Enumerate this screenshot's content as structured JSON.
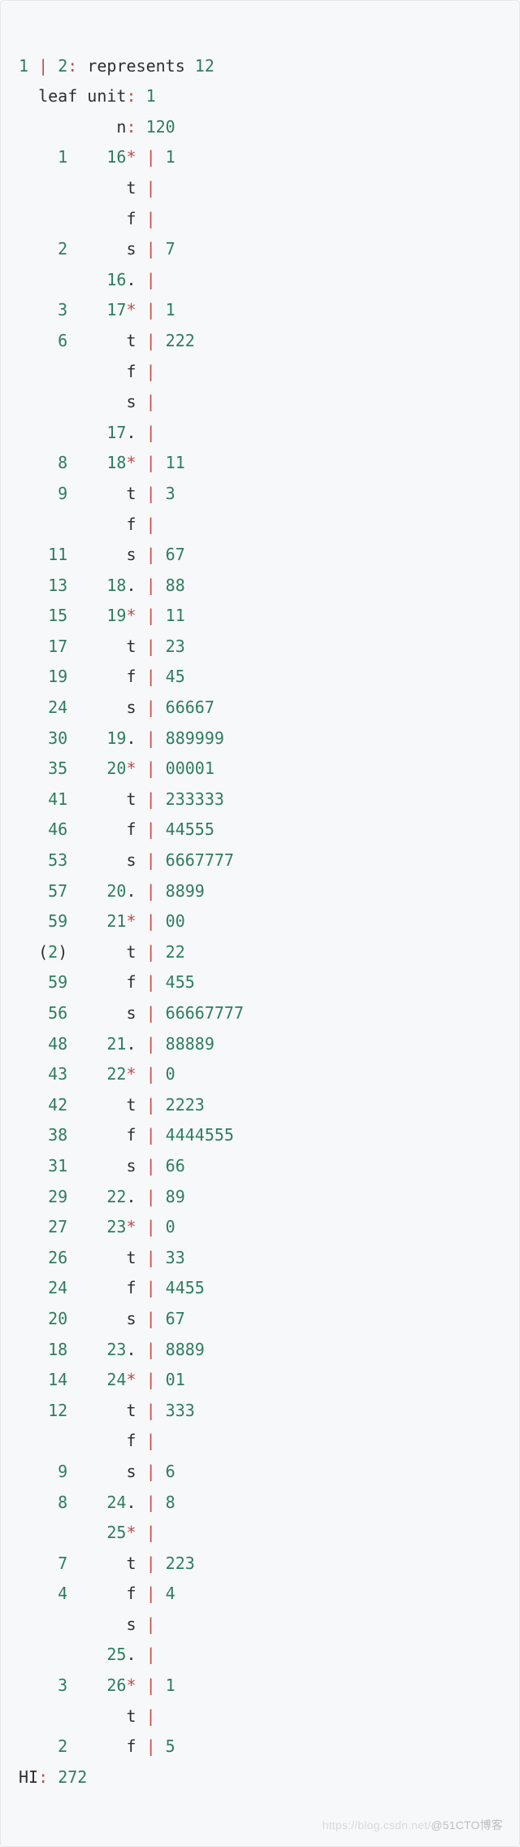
{
  "header": {
    "line1": {
      "n1": "1",
      "bar": "|",
      "n2": "2",
      "colon1": ":",
      "word": "represents",
      "n3": "12"
    },
    "line2": {
      "label": "leaf unit",
      "colon": ":",
      "val": "1"
    },
    "line3": {
      "label": "n",
      "colon": ":",
      "val": "120"
    }
  },
  "rows": [
    {
      "depth": "1",
      "stem_num": "16",
      "stem_sym": "*",
      "leaves": "1"
    },
    {
      "depth": "",
      "stem_num": "",
      "stem_sym": "t",
      "leaves": ""
    },
    {
      "depth": "",
      "stem_num": "",
      "stem_sym": "f",
      "leaves": ""
    },
    {
      "depth": "2",
      "stem_num": "",
      "stem_sym": "s",
      "leaves": "7"
    },
    {
      "depth": "",
      "stem_num": "16",
      "stem_sym": ".",
      "leaves": ""
    },
    {
      "depth": "3",
      "stem_num": "17",
      "stem_sym": "*",
      "leaves": "1"
    },
    {
      "depth": "6",
      "stem_num": "",
      "stem_sym": "t",
      "leaves": "222"
    },
    {
      "depth": "",
      "stem_num": "",
      "stem_sym": "f",
      "leaves": ""
    },
    {
      "depth": "",
      "stem_num": "",
      "stem_sym": "s",
      "leaves": ""
    },
    {
      "depth": "",
      "stem_num": "17",
      "stem_sym": ".",
      "leaves": ""
    },
    {
      "depth": "8",
      "stem_num": "18",
      "stem_sym": "*",
      "leaves": "11"
    },
    {
      "depth": "9",
      "stem_num": "",
      "stem_sym": "t",
      "leaves": "3"
    },
    {
      "depth": "",
      "stem_num": "",
      "stem_sym": "f",
      "leaves": ""
    },
    {
      "depth": "11",
      "stem_num": "",
      "stem_sym": "s",
      "leaves": "67"
    },
    {
      "depth": "13",
      "stem_num": "18",
      "stem_sym": ".",
      "leaves": "88"
    },
    {
      "depth": "15",
      "stem_num": "19",
      "stem_sym": "*",
      "leaves": "11"
    },
    {
      "depth": "17",
      "stem_num": "",
      "stem_sym": "t",
      "leaves": "23"
    },
    {
      "depth": "19",
      "stem_num": "",
      "stem_sym": "f",
      "leaves": "45"
    },
    {
      "depth": "24",
      "stem_num": "",
      "stem_sym": "s",
      "leaves": "66667"
    },
    {
      "depth": "30",
      "stem_num": "19",
      "stem_sym": ".",
      "leaves": "889999"
    },
    {
      "depth": "35",
      "stem_num": "20",
      "stem_sym": "*",
      "leaves": "00001"
    },
    {
      "depth": "41",
      "stem_num": "",
      "stem_sym": "t",
      "leaves": "233333"
    },
    {
      "depth": "46",
      "stem_num": "",
      "stem_sym": "f",
      "leaves": "44555"
    },
    {
      "depth": "53",
      "stem_num": "",
      "stem_sym": "s",
      "leaves": "6667777"
    },
    {
      "depth": "57",
      "stem_num": "20",
      "stem_sym": ".",
      "leaves": "8899"
    },
    {
      "depth": "59",
      "stem_num": "21",
      "stem_sym": "*",
      "leaves": "00"
    },
    {
      "depth": "(2)",
      "stem_num": "",
      "stem_sym": "t",
      "leaves": "22"
    },
    {
      "depth": "59",
      "stem_num": "",
      "stem_sym": "f",
      "leaves": "455"
    },
    {
      "depth": "56",
      "stem_num": "",
      "stem_sym": "s",
      "leaves": "66667777"
    },
    {
      "depth": "48",
      "stem_num": "21",
      "stem_sym": ".",
      "leaves": "88889"
    },
    {
      "depth": "43",
      "stem_num": "22",
      "stem_sym": "*",
      "leaves": "0"
    },
    {
      "depth": "42",
      "stem_num": "",
      "stem_sym": "t",
      "leaves": "2223"
    },
    {
      "depth": "38",
      "stem_num": "",
      "stem_sym": "f",
      "leaves": "4444555"
    },
    {
      "depth": "31",
      "stem_num": "",
      "stem_sym": "s",
      "leaves": "66"
    },
    {
      "depth": "29",
      "stem_num": "22",
      "stem_sym": ".",
      "leaves": "89"
    },
    {
      "depth": "27",
      "stem_num": "23",
      "stem_sym": "*",
      "leaves": "0"
    },
    {
      "depth": "26",
      "stem_num": "",
      "stem_sym": "t",
      "leaves": "33"
    },
    {
      "depth": "24",
      "stem_num": "",
      "stem_sym": "f",
      "leaves": "4455"
    },
    {
      "depth": "20",
      "stem_num": "",
      "stem_sym": "s",
      "leaves": "67"
    },
    {
      "depth": "18",
      "stem_num": "23",
      "stem_sym": ".",
      "leaves": "8889"
    },
    {
      "depth": "14",
      "stem_num": "24",
      "stem_sym": "*",
      "leaves": "01"
    },
    {
      "depth": "12",
      "stem_num": "",
      "stem_sym": "t",
      "leaves": "333"
    },
    {
      "depth": "",
      "stem_num": "",
      "stem_sym": "f",
      "leaves": ""
    },
    {
      "depth": "9",
      "stem_num": "",
      "stem_sym": "s",
      "leaves": "6"
    },
    {
      "depth": "8",
      "stem_num": "24",
      "stem_sym": ".",
      "leaves": "8"
    },
    {
      "depth": "",
      "stem_num": "25",
      "stem_sym": "*",
      "leaves": ""
    },
    {
      "depth": "7",
      "stem_num": "",
      "stem_sym": "t",
      "leaves": "223"
    },
    {
      "depth": "4",
      "stem_num": "",
      "stem_sym": "f",
      "leaves": "4"
    },
    {
      "depth": "",
      "stem_num": "",
      "stem_sym": "s",
      "leaves": ""
    },
    {
      "depth": "",
      "stem_num": "25",
      "stem_sym": ".",
      "leaves": ""
    },
    {
      "depth": "3",
      "stem_num": "26",
      "stem_sym": "*",
      "leaves": "1"
    },
    {
      "depth": "",
      "stem_num": "",
      "stem_sym": "t",
      "leaves": ""
    },
    {
      "depth": "2",
      "stem_num": "",
      "stem_sym": "f",
      "leaves": "5"
    }
  ],
  "footer": {
    "label": "HI",
    "colon": ":",
    "val": "272"
  },
  "watermark": {
    "faint": "https://blog.csdn.net/",
    "main": "@51CTO博客"
  }
}
